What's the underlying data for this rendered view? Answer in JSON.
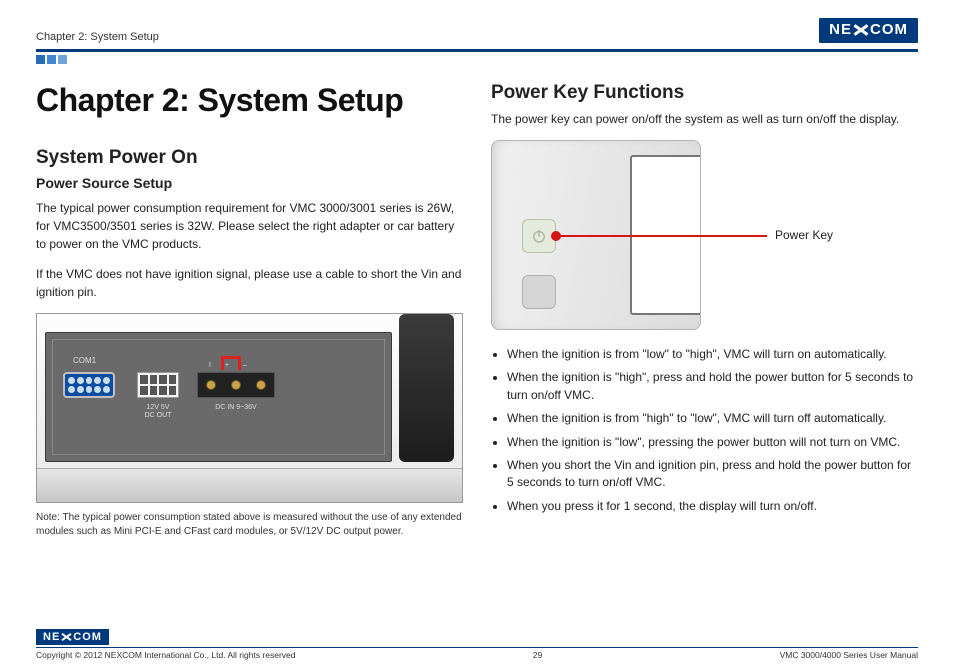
{
  "header": {
    "chapter_label": "Chapter 2: System Setup",
    "logo_pre": "NE",
    "logo_post": "COM"
  },
  "left": {
    "chapter_title": "Chapter 2: System Setup",
    "section_title": "System Power On",
    "subsection_title": "Power Source Setup",
    "para1": "The typical power consumption requirement for VMC 3000/3001 series is 26W, for VMC3500/3501 series is 32W. Please select the right adapter or car battery to power on the VMC products.",
    "para2": "If the VMC does not have ignition signal, please use a cable to short the Vin and ignition pin.",
    "fig": {
      "com_label": "COM1",
      "dcout_label": "12V 5V\nDC OUT",
      "dcin_top": "I + –",
      "dcin_label": "DC IN 9~36V"
    },
    "note": "Note: The typical power consumption stated above is measured without the use of any extended modules such as Mini PCI-E and CFast card modules, or 5V/12V DC output power."
  },
  "right": {
    "section_title": "Power Key Functions",
    "intro": "The power key can power on/off the system as well as turn on/off the display.",
    "callout": "Power Key",
    "bullets": [
      "When the ignition is from \"low\" to \"high\", VMC will turn on automatically.",
      "When the ignition is \"high\", press and hold the power button for 5 seconds to turn on/off VMC.",
      "When the ignition is from \"high\" to \"low\", VMC will turn off automatically.",
      "When the ignition is \"low\", pressing the power button will not turn on VMC.",
      "When you short the Vin and ignition pin, press and hold the power button for 5 seconds to turn on/off VMC.",
      "When you press it for 1 second, the display will turn on/off."
    ]
  },
  "footer": {
    "copyright": "Copyright © 2012 NEXCOM International Co., Ltd. All rights reserved",
    "page": "29",
    "manual": "VMC 3000/4000 Series User Manual"
  }
}
